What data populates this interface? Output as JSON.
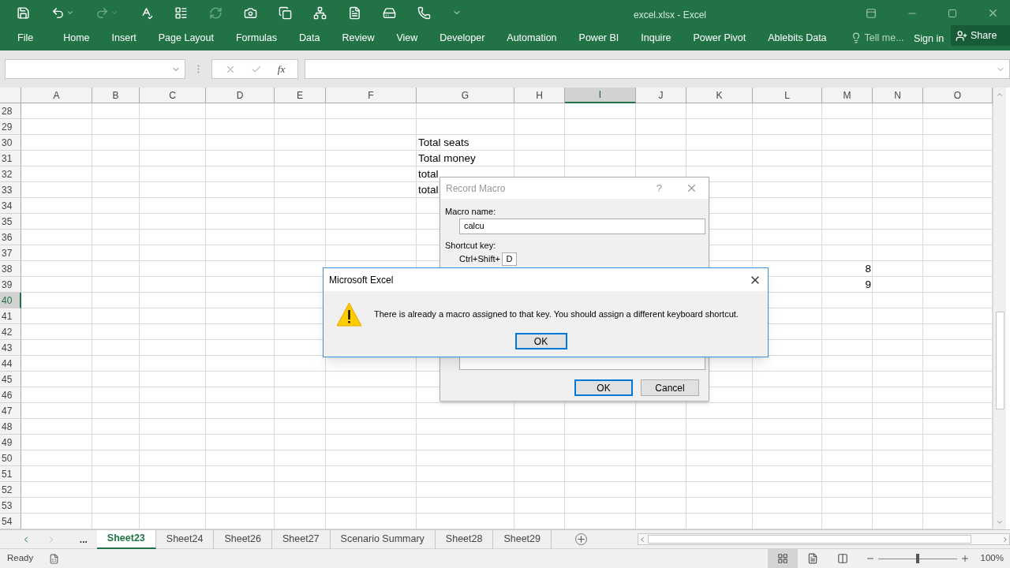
{
  "window": {
    "title": "excel.xlsx - Excel"
  },
  "ribbon_tabs": [
    {
      "label": "File"
    },
    {
      "label": "Home"
    },
    {
      "label": "Insert"
    },
    {
      "label": "Page Layout"
    },
    {
      "label": "Formulas"
    },
    {
      "label": "Data"
    },
    {
      "label": "Review"
    },
    {
      "label": "View"
    },
    {
      "label": "Developer"
    },
    {
      "label": "Automation"
    },
    {
      "label": "Power BI"
    },
    {
      "label": "Inquire"
    },
    {
      "label": "Power Pivot"
    },
    {
      "label": "Ablebits Data"
    }
  ],
  "tell_me": {
    "placeholder": "Tell me..."
  },
  "sign_in": "Sign in",
  "share": "Share",
  "formula_bar": {
    "function_label": "fx"
  },
  "columns": [
    {
      "label": "A",
      "selected": false
    },
    {
      "label": "B",
      "selected": false
    },
    {
      "label": "C",
      "selected": false
    },
    {
      "label": "D",
      "selected": false
    },
    {
      "label": "E",
      "selected": false
    },
    {
      "label": "F",
      "selected": false
    },
    {
      "label": "G",
      "selected": false
    },
    {
      "label": "H",
      "selected": false
    },
    {
      "label": "I",
      "selected": true
    },
    {
      "label": "J",
      "selected": false
    },
    {
      "label": "K",
      "selected": false
    },
    {
      "label": "L",
      "selected": false
    },
    {
      "label": "M",
      "selected": false
    },
    {
      "label": "N",
      "selected": false
    },
    {
      "label": "O",
      "selected": false
    }
  ],
  "rows": [
    {
      "number": "28",
      "selected": false,
      "cells": {}
    },
    {
      "number": "29",
      "selected": false,
      "cells": {}
    },
    {
      "number": "30",
      "selected": false,
      "cells": {
        "G": {
          "kind": "text",
          "text": "Total seats"
        }
      }
    },
    {
      "number": "31",
      "selected": false,
      "cells": {
        "G": {
          "kind": "text",
          "text": "Total money"
        }
      }
    },
    {
      "number": "32",
      "selected": false,
      "cells": {
        "G": {
          "kind": "text",
          "text": "total"
        }
      }
    },
    {
      "number": "33",
      "selected": false,
      "cells": {
        "G": {
          "kind": "text",
          "text": "total"
        }
      }
    },
    {
      "number": "34",
      "selected": false,
      "cells": {}
    },
    {
      "number": "35",
      "selected": false,
      "cells": {}
    },
    {
      "number": "36",
      "selected": false,
      "cells": {}
    },
    {
      "number": "37",
      "selected": false,
      "cells": {}
    },
    {
      "number": "38",
      "selected": false,
      "cells": {
        "M": {
          "kind": "number",
          "text": "8"
        }
      }
    },
    {
      "number": "39",
      "selected": false,
      "cells": {
        "M": {
          "kind": "number",
          "text": "9"
        }
      }
    },
    {
      "number": "40",
      "selected": true,
      "cells": {}
    },
    {
      "number": "41",
      "selected": false,
      "cells": {}
    },
    {
      "number": "42",
      "selected": false,
      "cells": {}
    },
    {
      "number": "43",
      "selected": false,
      "cells": {}
    },
    {
      "number": "44",
      "selected": false,
      "cells": {}
    },
    {
      "number": "45",
      "selected": false,
      "cells": {}
    },
    {
      "number": "46",
      "selected": false,
      "cells": {}
    },
    {
      "number": "47",
      "selected": false,
      "cells": {}
    },
    {
      "number": "48",
      "selected": false,
      "cells": {}
    },
    {
      "number": "49",
      "selected": false,
      "cells": {}
    },
    {
      "number": "50",
      "selected": false,
      "cells": {}
    },
    {
      "number": "51",
      "selected": false,
      "cells": {}
    },
    {
      "number": "52",
      "selected": false,
      "cells": {}
    },
    {
      "number": "53",
      "selected": false,
      "cells": {}
    },
    {
      "number": "54",
      "selected": false,
      "cells": {}
    }
  ],
  "sheet_tabs": {
    "more": "...",
    "tabs": [
      {
        "label": "Sheet23",
        "selected": true
      },
      {
        "label": "Sheet24",
        "selected": false
      },
      {
        "label": "Sheet26",
        "selected": false
      },
      {
        "label": "Sheet27",
        "selected": false
      },
      {
        "label": "Scenario Summary",
        "selected": false
      },
      {
        "label": "Sheet28",
        "selected": false
      },
      {
        "label": "Sheet29",
        "selected": false
      }
    ]
  },
  "status_bar": {
    "status": "Ready",
    "views": [
      {
        "kind": "normal",
        "selected": true
      },
      {
        "kind": "page_layout",
        "selected": false
      },
      {
        "kind": "page_break",
        "selected": false
      }
    ],
    "zoom": {
      "level": 0.5,
      "reading": "100%"
    }
  },
  "record_macro_dialog": {
    "title": "Record Macro",
    "help": "?",
    "macro_name_label": "Macro name:",
    "macro_name": "calcu",
    "shortcut_label": "Shortcut key:",
    "shortcut_prefix": "Ctrl+Shift+",
    "shortcut_key": "D",
    "buttons": [
      {
        "label": "OK",
        "default": true
      },
      {
        "label": "Cancel",
        "default": false
      }
    ]
  },
  "alert_dialog": {
    "title": "Microsoft Excel",
    "message": "There is already a macro assigned to that key. You should assign a different keyboard shortcut.",
    "buttons": [
      {
        "label": "OK",
        "default": true
      }
    ]
  }
}
